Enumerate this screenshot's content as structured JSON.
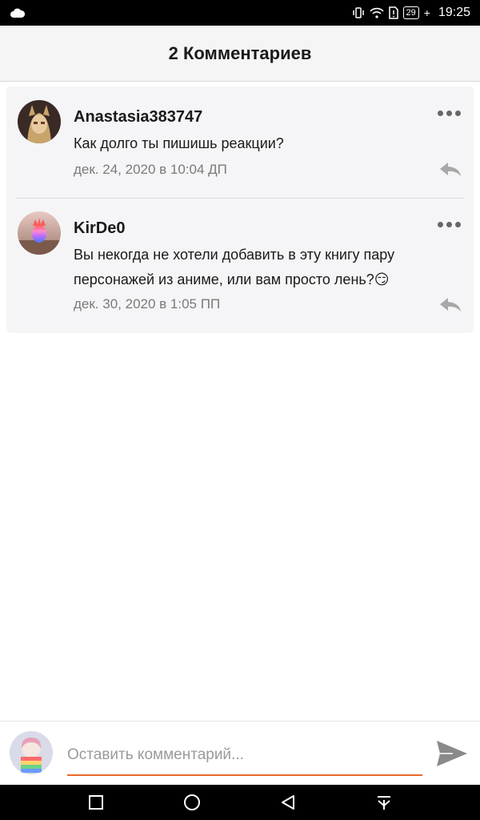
{
  "status_bar": {
    "battery": "29",
    "time": "19:25",
    "icons": [
      "cloud-icon",
      "vibrate-icon",
      "wifi-icon",
      "sim-icon",
      "battery-icon"
    ]
  },
  "header": {
    "title": "2 Комментариев"
  },
  "comments": [
    {
      "username": "Anastasia383747",
      "text": "Как долго ты пишишь реакции?",
      "date": "дек. 24, 2020 в 10:04 ДП"
    },
    {
      "username": "KirDe0",
      "text": "Вы некогда не хотели добавить в эту книгу пару персонажей из аниме, или вам просто лень?😏",
      "date": "дек. 30, 2020 в 1:05 ПП"
    }
  ],
  "comment_input": {
    "placeholder": "Оставить комментарий...",
    "value": ""
  },
  "colors": {
    "accent": "#e86a2a",
    "header_bg": "#f5f5f5",
    "card_bg": "#f5f5f7"
  }
}
